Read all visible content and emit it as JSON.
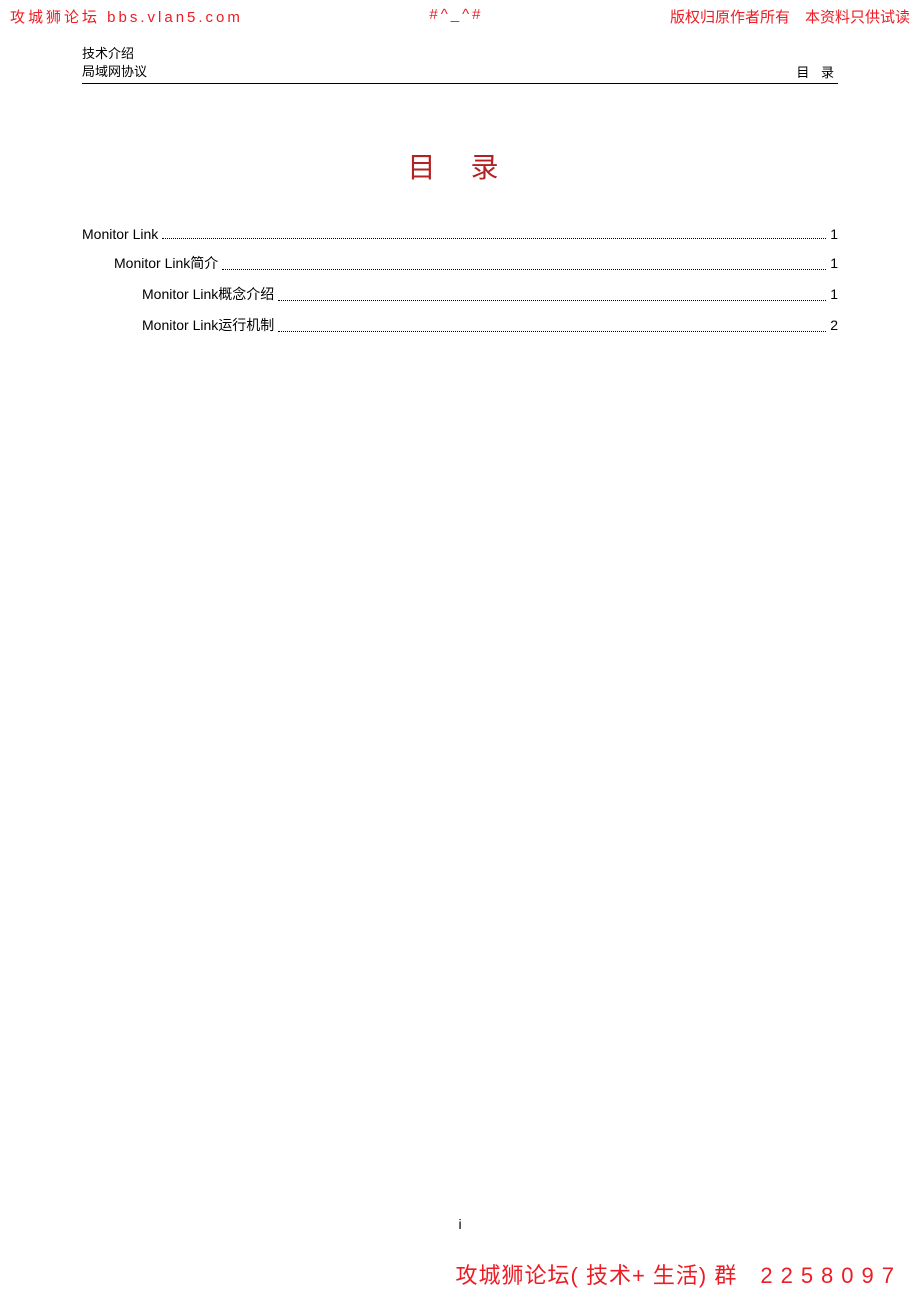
{
  "watermarkTop": {
    "left": "攻城狮论坛 bbs.vlan5.com",
    "center": "#^_^#",
    "right": "版权归原作者所有　本资料只供试读"
  },
  "header": {
    "line1": "技术介绍",
    "line2": "局域网协议",
    "right": "目 录"
  },
  "tocTitle": "目 录",
  "toc": [
    {
      "label": "Monitor Link",
      "page": "1",
      "indent": 0
    },
    {
      "label": "Monitor Link简介",
      "page": "1",
      "indent": 1
    },
    {
      "label": "Monitor Link概念介绍",
      "page": "1",
      "indent": 2
    },
    {
      "label": "Monitor Link运行机制",
      "page": "2",
      "indent": 2
    }
  ],
  "pageNumber": "i",
  "watermarkBottom": {
    "text": "攻城狮论坛( 技术+ 生活) 群　",
    "num": "2258097"
  }
}
